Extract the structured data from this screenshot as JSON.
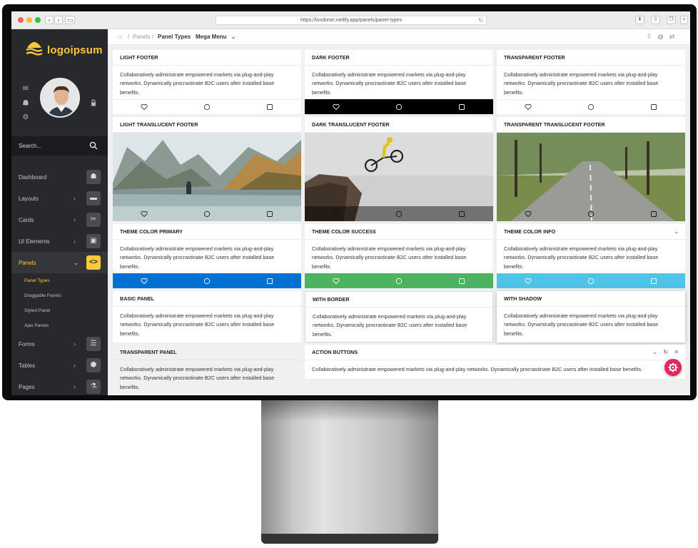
{
  "browser": {
    "url": "https://londoner.netlify.app/panels/panel-types"
  },
  "brand": {
    "name": "logoipsum",
    "color": "#ffc93c"
  },
  "sidebar": {
    "search_placeholder": "Search...",
    "items": [
      {
        "label": "Dashboard",
        "icon": "gamepad-icon",
        "has_children": false
      },
      {
        "label": "Layouts",
        "icon": "monitor-icon",
        "has_children": true
      },
      {
        "label": "Cards",
        "icon": "scissors-icon",
        "has_children": true
      },
      {
        "label": "UI Elements",
        "icon": "image-icon",
        "has_children": true
      },
      {
        "label": "Panels",
        "icon": "code-icon",
        "has_children": true,
        "active": true
      },
      {
        "label": "Forms",
        "icon": "sliders-icon",
        "has_children": true
      },
      {
        "label": "Tables",
        "icon": "cube-icon",
        "has_children": true
      },
      {
        "label": "Pages",
        "icon": "flask-icon",
        "has_children": true
      }
    ],
    "sub_items": [
      {
        "label": "Panel Types",
        "active": true
      },
      {
        "label": "Draggable Panels"
      },
      {
        "label": "Styled Panel"
      },
      {
        "label": "Ajax Panels"
      }
    ]
  },
  "header": {
    "breadcrumb": [
      "Panels",
      "Panel Types"
    ],
    "mega_menu": "Mega Menu"
  },
  "panel_text": "Collaboratively administrate empowered markets via plug-and-play networks. Dynamically procrastinate B2C users after installed base benefits.",
  "panels": {
    "light_footer": "LIGHT FOOTER",
    "dark_footer": "DARK FOOTER",
    "transparent_footer": "TRANSPARENT FOOTER",
    "light_translucent": "LIGHT TRANSLUCENT FOOTER",
    "dark_translucent": "DARK TRANSLUCENT FOOTER",
    "transparent_translucent": "TRANSPARENT TRANSLUCENT FOOTER",
    "theme_primary": "THEME COLOR PRIMARY",
    "theme_success": "THEME COLOR SUCCESS",
    "theme_info": "THEME COLOR INFO",
    "basic": "BASIC PANEL",
    "with_border": "WITH BORDER",
    "with_shadow": "WITH SHADOW",
    "transparent_panel": "TRANSPARENT PANEL",
    "action_buttons": "ACTION BUTTONS"
  },
  "footer_icons": [
    "heart-icon",
    "circle-icon",
    "square-icon"
  ],
  "colors": {
    "primary": "#0070d2",
    "success": "#4cb461",
    "info": "#4fc3e8",
    "accent": "#ffc93c",
    "fab": "#e2285a"
  }
}
